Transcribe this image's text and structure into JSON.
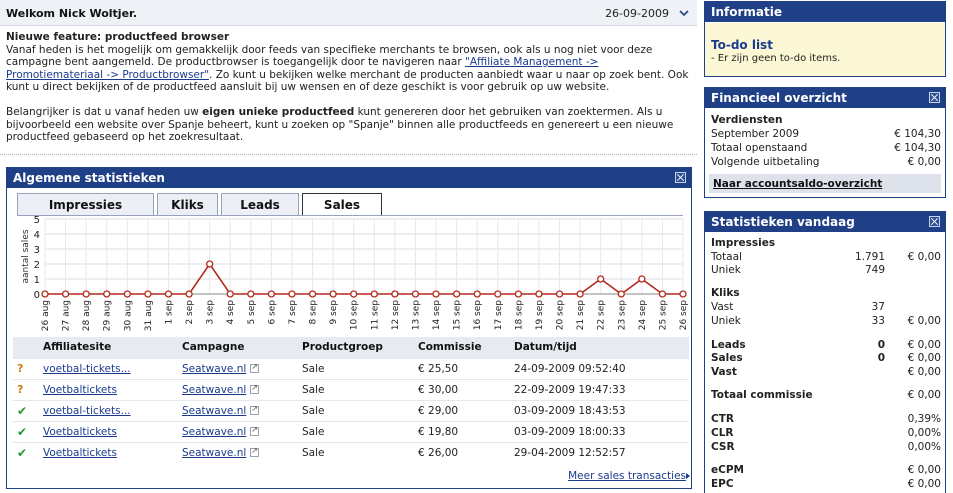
{
  "header": {
    "welcome": "Welkom Nick Woltjer.",
    "date": "26-09-2009"
  },
  "news": {
    "title": "Nieuwe feature: productfeed browser",
    "p1_before": "Vanaf heden is het mogelijk om gemakkelijk door feeds van specifieke merchants te browsen, ook als u nog niet voor deze campagne bent aangemeld. De productbrowser is toegangelijk door te navigeren naar ",
    "p1_link": "\"Affiliate Management -> Promotiemateriaal -> Productbrowser\"",
    "p1_after": ". Zo kunt u bekijken welke merchant de producten aanbiedt waar u naar op zoek bent. Ook kunt u direct bekijken of de productfeed aansluit bij uw wensen en of deze geschikt is voor gebruik op uw website.",
    "p2_before": "Belangrijker is dat u vanaf heden uw ",
    "p2_bold": "eigen unieke productfeed",
    "p2_after": " kunt genereren door het gebruiken van zoektermen. Als u bijvoorbeeld een website over Spanje beheert, kunt u zoeken op \"Spanje\" binnen alle productfeeds en genereert u een nieuwe productfeed gebaseerd op het zoekresultaat."
  },
  "stats": {
    "title": "Algemene statistieken",
    "tabs": [
      "Impressies",
      "Kliks",
      "Leads",
      "Sales"
    ],
    "active_tab": "Sales",
    "table": {
      "headers": [
        "Affiliatesite",
        "Campagne",
        "Productgroep",
        "Commissie",
        "Datum/tijd"
      ],
      "rows": [
        {
          "status": "pending",
          "site": "voetbal-tickets...",
          "campaign": "Seatwave.nl",
          "group": "Sale",
          "commission": "€ 25,50",
          "datetime": "24-09-2009 09:52:40"
        },
        {
          "status": "pending",
          "site": "Voetbaltickets",
          "campaign": "Seatwave.nl",
          "group": "Sale",
          "commission": "€ 30,00",
          "datetime": "22-09-2009 19:47:33"
        },
        {
          "status": "approved",
          "site": "voetbal-tickets...",
          "campaign": "Seatwave.nl",
          "group": "Sale",
          "commission": "€ 29,00",
          "datetime": "03-09-2009 18:43:53"
        },
        {
          "status": "approved",
          "site": "Voetbaltickets",
          "campaign": "Seatwave.nl",
          "group": "Sale",
          "commission": "€ 19,80",
          "datetime": "03-09-2009 18:00:33"
        },
        {
          "status": "approved",
          "site": "Voetbaltickets",
          "campaign": "Seatwave.nl",
          "group": "Sale",
          "commission": "€ 26,00",
          "datetime": "29-04-2009 12:52:57"
        }
      ]
    },
    "more_link": "Meer sales transacties"
  },
  "chart_data": {
    "type": "line",
    "ylabel": "aantal sales",
    "ylim": [
      0,
      5
    ],
    "yticks": [
      0,
      1,
      2,
      3,
      4,
      5
    ],
    "grid": true,
    "x": [
      "26 aug",
      "27 aug",
      "28 aug",
      "29 aug",
      "30 aug",
      "31 aug",
      "1 sep",
      "2 sep",
      "3 sep",
      "4 sep",
      "5 sep",
      "6 sep",
      "7 sep",
      "8 sep",
      "9 sep",
      "10 sep",
      "11 sep",
      "12 sep",
      "13 sep",
      "14 sep",
      "15 sep",
      "16 sep",
      "17 sep",
      "18 sep",
      "19 sep",
      "20 sep",
      "21 sep",
      "22 sep",
      "23 sep",
      "24 sep",
      "25 sep",
      "26 sep"
    ],
    "series": [
      {
        "values": [
          0,
          0,
          0,
          0,
          0,
          0,
          0,
          0,
          2,
          0,
          0,
          0,
          0,
          0,
          0,
          0,
          0,
          0,
          0,
          0,
          0,
          0,
          0,
          0,
          0,
          0,
          0,
          1,
          0,
          1,
          0,
          0
        ]
      }
    ],
    "line_color": "#b52a1e"
  },
  "info": {
    "title": "Informatie",
    "todo_title": "To-do list",
    "todo_text": "- Er zijn geen to-do items."
  },
  "finance": {
    "title": "Financieel overzicht",
    "section": "Verdiensten",
    "rows": [
      {
        "label": "September 2009",
        "value": "€ 104,30"
      },
      {
        "label": "Totaal openstaand",
        "value": "€ 104,30"
      },
      {
        "label": "Volgende uitbetaling",
        "value": "€ 0,00"
      }
    ],
    "link": "Naar accountsaldo-overzicht"
  },
  "today": {
    "title": "Statistieken vandaag",
    "impressions_title": "Impressies",
    "impressions": [
      {
        "label": "Totaal",
        "count": "1.791",
        "value": "€ 0,00"
      },
      {
        "label": "Uniek",
        "count": "749",
        "value": ""
      }
    ],
    "clicks_title": "Kliks",
    "clicks": [
      {
        "label": "Vast",
        "count": "37",
        "value": ""
      },
      {
        "label": "Uniek",
        "count": "33",
        "value": "€ 0,00"
      }
    ],
    "leads": {
      "label": "Leads",
      "count": "0",
      "value": "€ 0,00"
    },
    "sales": {
      "label": "Sales",
      "count": "0",
      "value": "€ 0,00"
    },
    "vast": {
      "label": "Vast",
      "value": "€ 0,00"
    },
    "total_commission": {
      "label": "Totaal commissie",
      "value": "€ 0,00"
    },
    "ctr": {
      "label": "CTR",
      "value": "0,39%"
    },
    "clr": {
      "label": "CLR",
      "value": "0,00%"
    },
    "csr": {
      "label": "CSR",
      "value": "0,00%"
    },
    "ecpm": {
      "label": "eCPM",
      "value": "€ 0,00"
    },
    "epc": {
      "label": "EPC",
      "value": "€ 0,00"
    }
  }
}
